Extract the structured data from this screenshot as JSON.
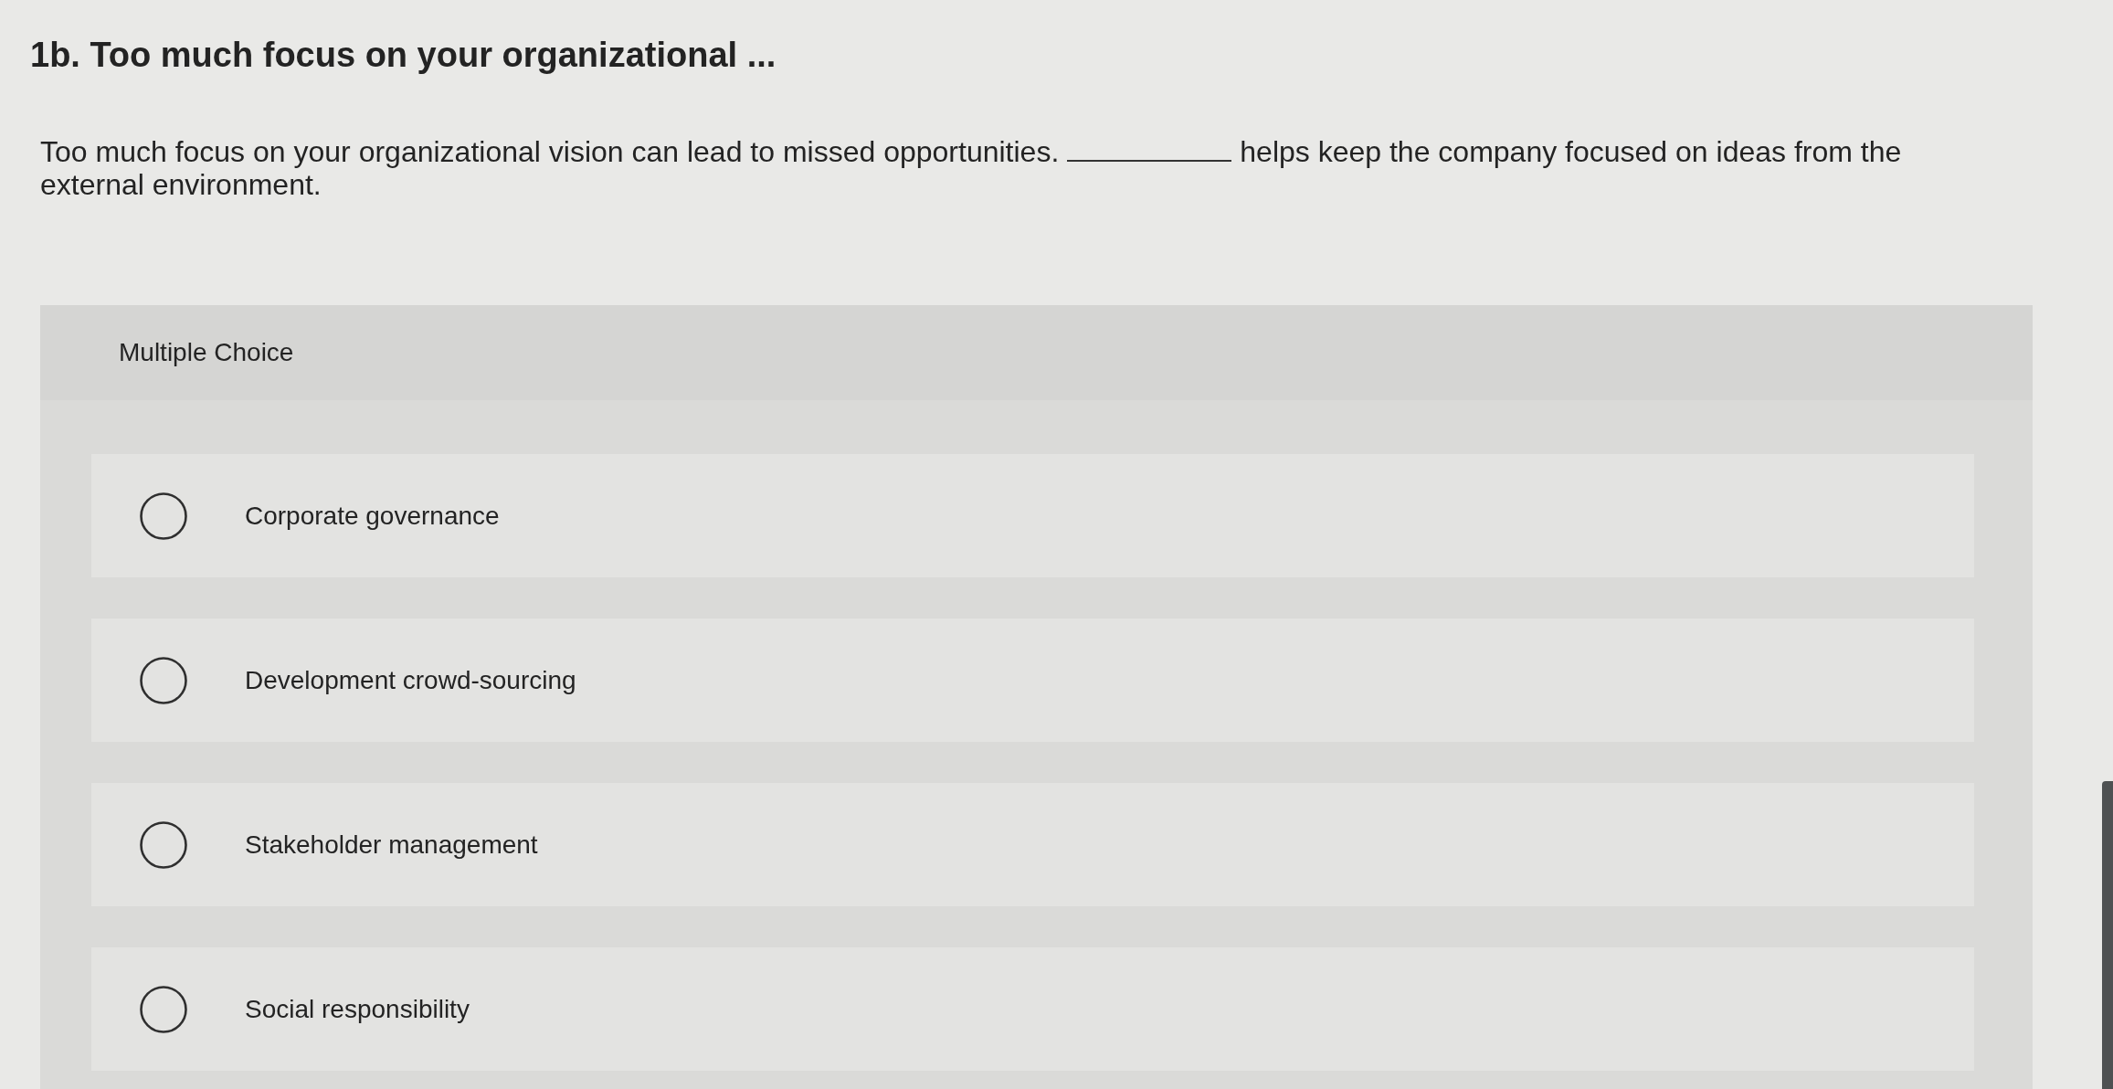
{
  "question": {
    "title": "1b. Too much focus on your organizational ...",
    "text_before_blank": "Too much focus on your organizational vision can lead to missed opportunities.",
    "text_after_blank": "helps keep the company focused on ideas from the",
    "text_continued": "external environment."
  },
  "answer_panel": {
    "heading": "Multiple Choice",
    "options": [
      {
        "label": "Corporate governance",
        "selected": false
      },
      {
        "label": "Development crowd-sourcing",
        "selected": false
      },
      {
        "label": "Stakeholder management",
        "selected": false
      },
      {
        "label": "Social responsibility",
        "selected": false
      }
    ]
  }
}
